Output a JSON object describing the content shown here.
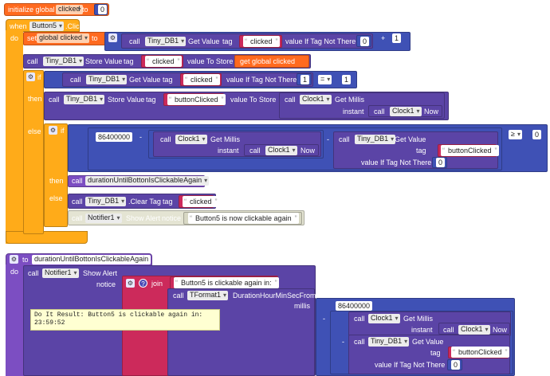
{
  "init": {
    "prefix": "initialize global",
    "var_name": "clicked",
    "to": "to",
    "value": "0"
  },
  "event": {
    "when": "when",
    "component": "Button5",
    "event": ".Click",
    "do": "do"
  },
  "set_block": {
    "set": "set",
    "var": "global clicked",
    "to": "to"
  },
  "plus": {
    "op": "+",
    "right": "1"
  },
  "get_value": {
    "call": "call",
    "component": "Tiny_DB1",
    "method": "Get Value",
    "tag_label": "tag",
    "tag": "clicked",
    "default_label": "value If Tag Not There",
    "default": "0"
  },
  "store1": {
    "call": "call",
    "component": "Tiny_DB1",
    "method": "Store Value",
    "tag_label": "tag",
    "tag": "clicked",
    "value_label": "value To Store",
    "value": "get global clicked"
  },
  "if1": {
    "if_label": "if",
    "then_label": "then",
    "else_label": "else"
  },
  "cond1": {
    "call": "call",
    "component": "Tiny_DB1",
    "method": "Get Value",
    "tag_label": "tag",
    "tag": "clicked",
    "default_label": "value If Tag Not There",
    "default": "1",
    "op": "=",
    "right": "1"
  },
  "store2": {
    "call": "call",
    "component": "Tiny_DB1",
    "method": "Store Value",
    "tag_label": "tag",
    "tag": "buttonClicked",
    "value_label": "value To Store",
    "clock_call": "call",
    "clock": "Clock1",
    "clock_method": "Get Millis",
    "instant_label": "instant",
    "now_call": "call",
    "now_clock": "Clock1",
    "now_method": "Now"
  },
  "if2": {
    "if_label": "if",
    "then_label": "then",
    "else_label": "else"
  },
  "cond2": {
    "number": "86400000",
    "minus": "-",
    "minus2": "-",
    "getmillis_call": "call",
    "getmillis_clock": "Clock1",
    "getmillis_method": "Get Millis",
    "instant_label": "instant",
    "now_call": "call",
    "now_clock": "Clock1",
    "now_method": "Now",
    "gv_call": "call",
    "gv_component": "Tiny_DB1",
    "gv_method": "Get Value",
    "gv_tag_label": "tag",
    "gv_tag": "buttonClicked",
    "gv_default_label": "value If Tag Not There",
    "gv_default": "0",
    "op": "≥",
    "right": "0"
  },
  "then2": {
    "call": "call",
    "procedure": "durationUntilBottonIsClickableAgain"
  },
  "else2": {
    "clear_call": "call",
    "clear_component": "Tiny_DB1",
    "clear_method": ".Clear Tag",
    "clear_tag_label": "tag",
    "clear_tag": "clicked",
    "notifier_call": "call",
    "notifier": "Notifier1",
    "notifier_method": "Show Alert",
    "notice_label": "notice",
    "notice": "Button5 is now clickable again"
  },
  "proc": {
    "to": "to",
    "name": "durationUntilBottonIsClickableAgain",
    "do": "do"
  },
  "alert": {
    "call": "call",
    "notifier": "Notifier1",
    "method": "Show Alert",
    "notice_label": "notice",
    "join": "join",
    "string": "Button5 is clickable again in:",
    "fmt_call": "call",
    "fmt_component": "TFormat1",
    "fmt_method": "DurationHourMinSecFrom",
    "millis_label": "millis",
    "number": "86400000",
    "minus": "-",
    "minus2": "-",
    "gm_call": "call",
    "gm_clock": "Clock1",
    "gm_method": "Get Millis",
    "instant_label": "instant",
    "now_call": "call",
    "now_clock": "Clock1",
    "now_method": "Now",
    "gv_call": "call",
    "gv_component": "Tiny_DB1",
    "gv_method": "Get Value",
    "gv_tag_label": "tag",
    "gv_tag": "buttonClicked",
    "gv_default_label": "value If Tag Not There",
    "gv_default": "0"
  },
  "do_it": {
    "line1": "Do It Result: Button5 is clickable again in:",
    "line2": "23:59:52"
  },
  "colors": {
    "control": "#ffab19",
    "variable": "#ff6a1f",
    "component": "#5b44a6",
    "math": "#3f51b5",
    "text": "#cc2a5b",
    "procedure": "#7c4ec2"
  }
}
